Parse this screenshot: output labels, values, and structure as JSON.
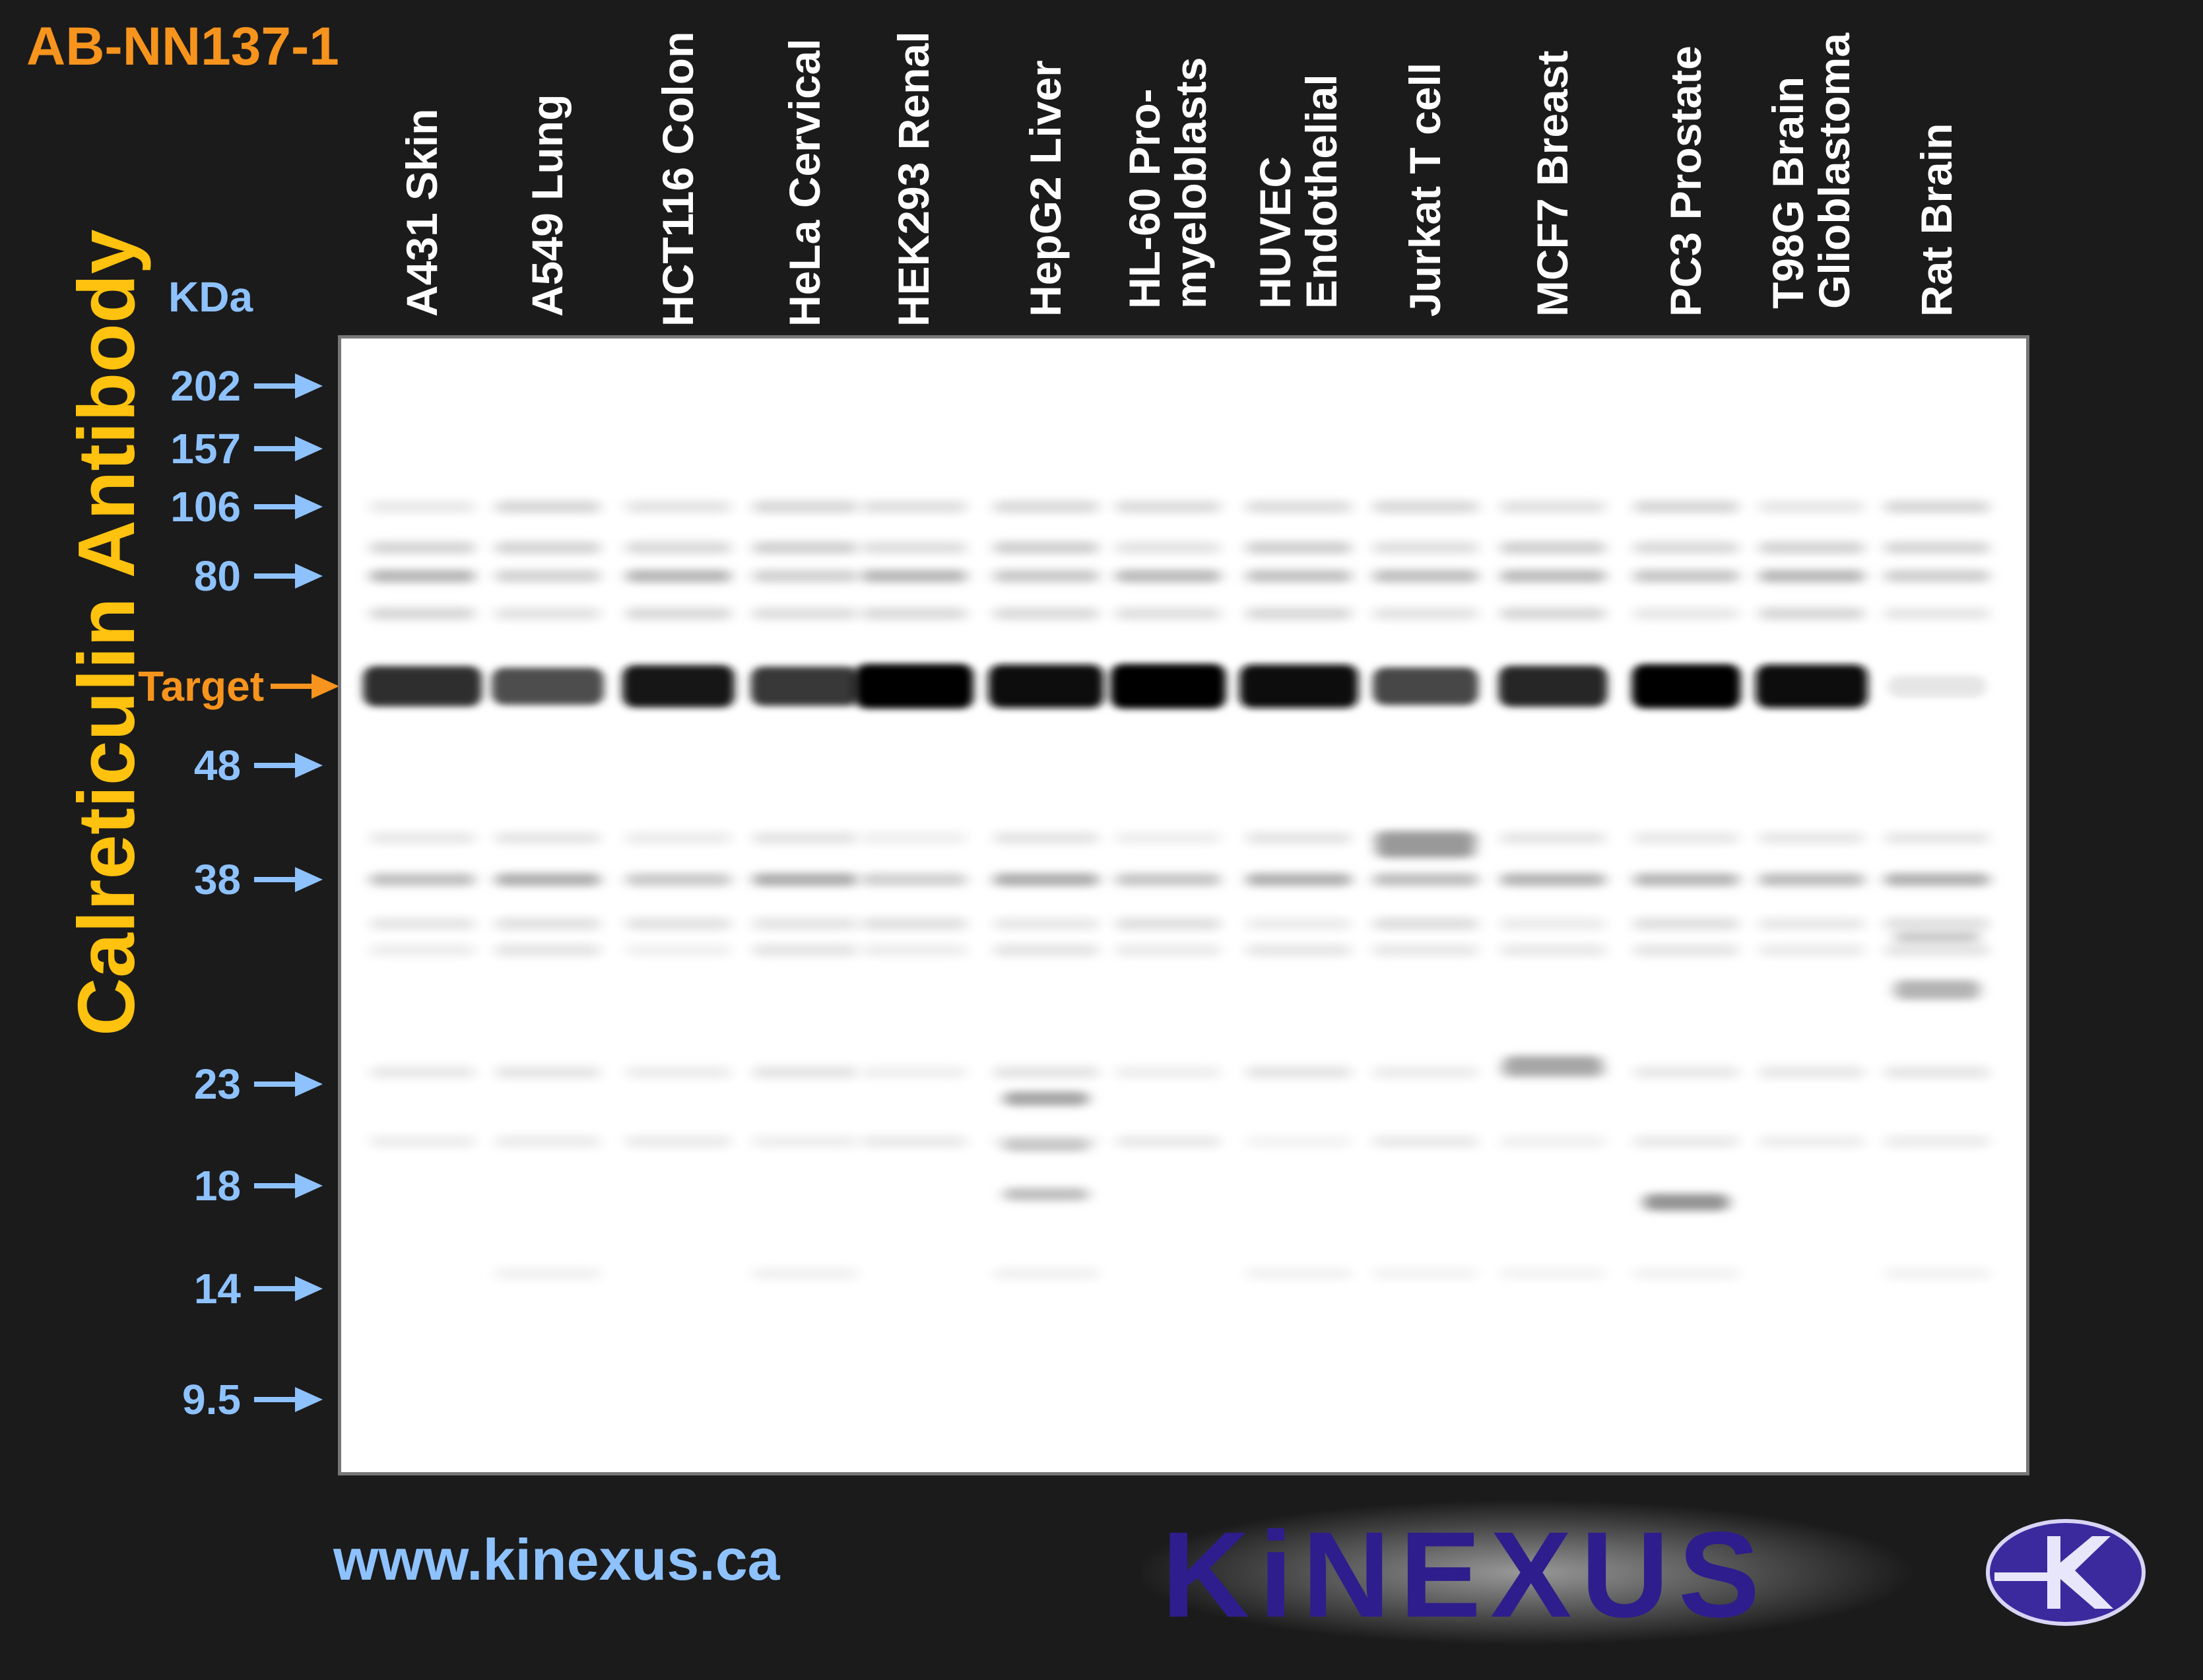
{
  "product_code": "AB-NN137-1",
  "antibody_name": "Calreticulin Antibody",
  "kda_label": "KDa",
  "lanes": [
    {
      "lines": [
        "A431 Skin"
      ]
    },
    {
      "lines": [
        "A549 Lung"
      ]
    },
    {
      "lines": [
        "HCT116 Colon"
      ]
    },
    {
      "lines": [
        "HeLa Cervical"
      ]
    },
    {
      "lines": [
        "HEK293 Renal"
      ]
    },
    {
      "lines": [
        "HepG2 Liver"
      ]
    },
    {
      "lines": [
        "HL-60 Pro-",
        "myeloblasts"
      ]
    },
    {
      "lines": [
        "HUVEC",
        "Endothelial"
      ]
    },
    {
      "lines": [
        "Jurkat T cell"
      ]
    },
    {
      "lines": [
        "MCF7 Breast"
      ]
    },
    {
      "lines": [
        "PC3 Prostate"
      ]
    },
    {
      "lines": [
        "T98G Brain",
        "Glioblastoma"
      ]
    },
    {
      "lines": [
        "Rat Brain"
      ]
    }
  ],
  "markers": [
    "202",
    "157",
    "106",
    "80",
    "Target",
    "48",
    "38",
    "23",
    "18",
    "14",
    "9.5"
  ],
  "target_label": "Target",
  "target_band_intensity": [
    0.82,
    0.7,
    0.9,
    0.78,
    1.0,
    0.95,
    1.0,
    0.95,
    0.72,
    0.85,
    0.98,
    0.95,
    0.1
  ],
  "website": "www.kinexus.ca",
  "logo_text": "KiNEXUS",
  "colors": {
    "background": "#1b1b1b",
    "product_code": "#f7941d",
    "title": "#ffc20e",
    "marker_text": "#8ec2ff",
    "target": "#f7941d",
    "logo": "#2e1d8c"
  }
}
